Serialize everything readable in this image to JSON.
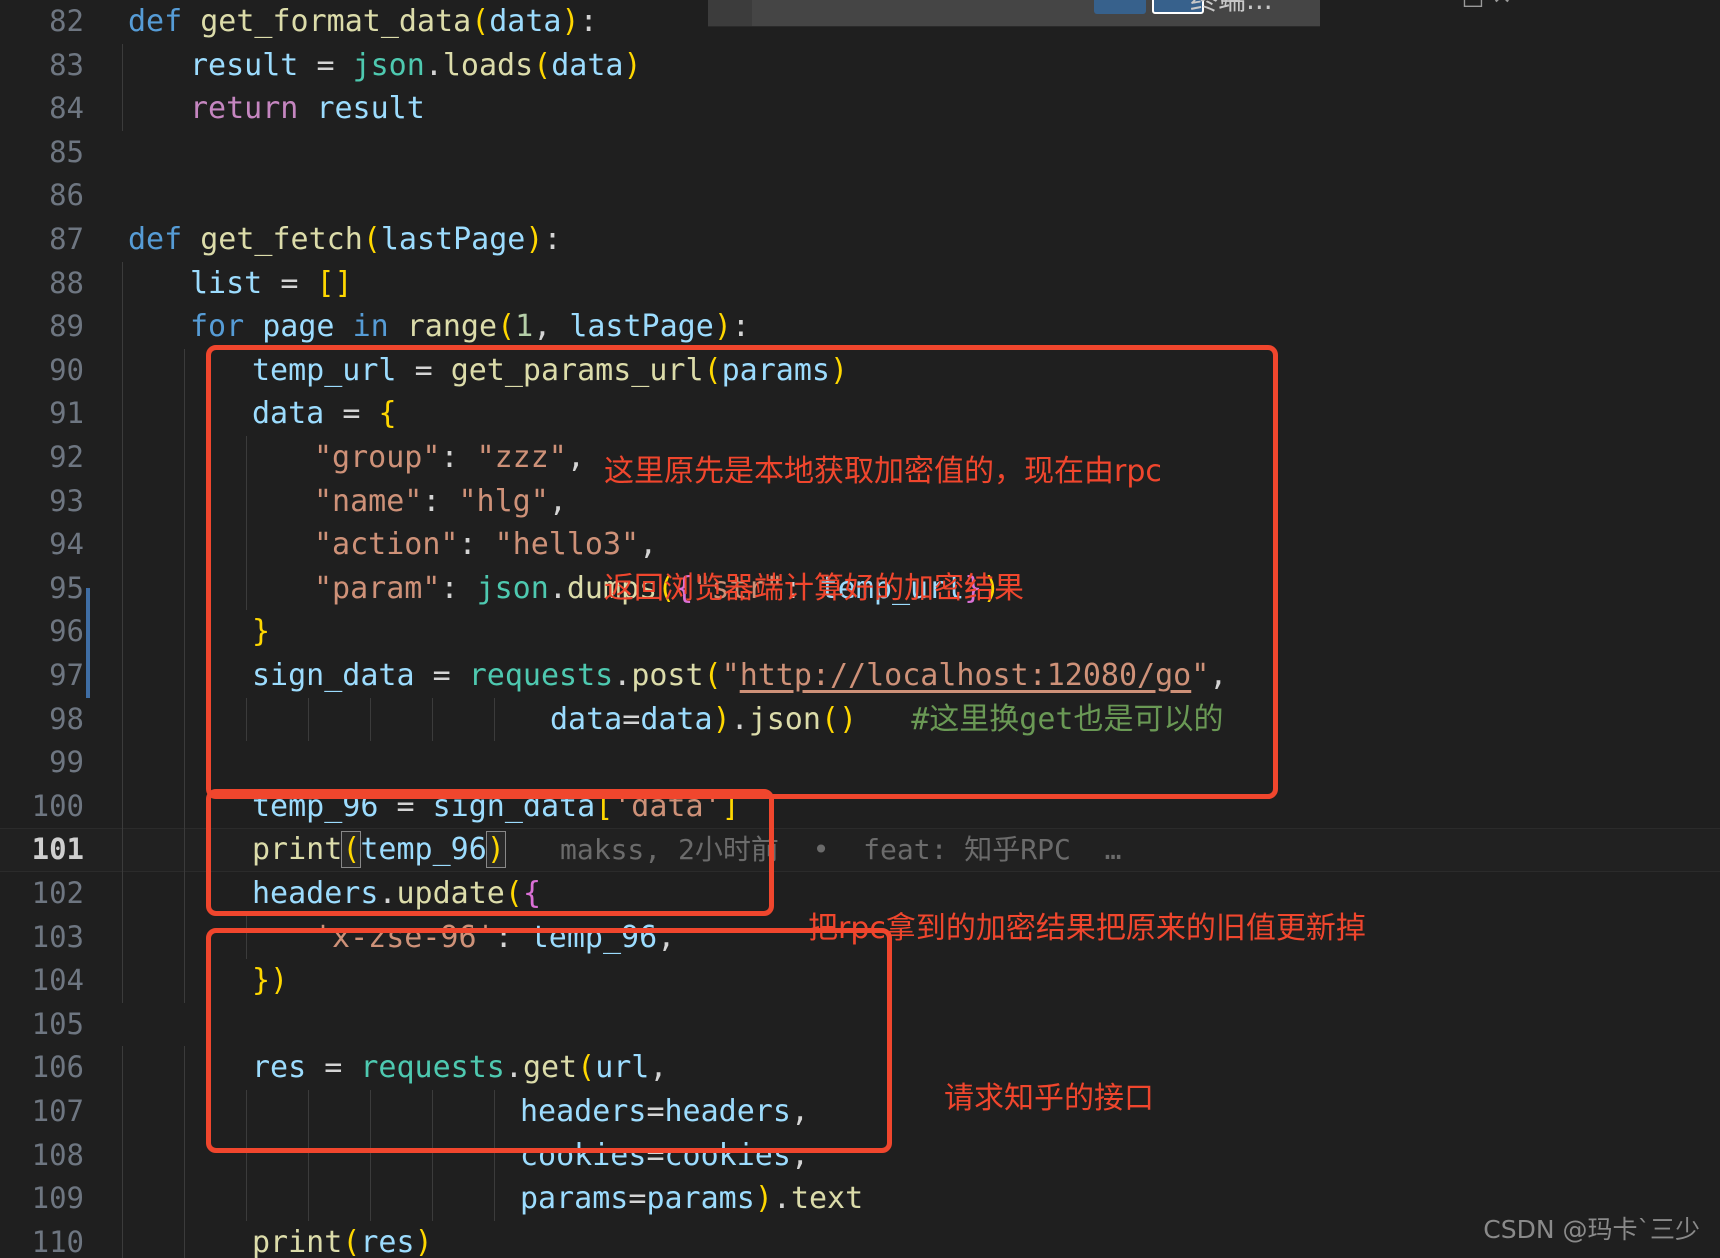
{
  "window": {
    "theme_background": "#1f1f1f",
    "accent_annotation_color": "#f0462d",
    "terminal_label": "终端...",
    "terminal_icons": "—  □  ✕"
  },
  "editor": {
    "first_line_number": 82,
    "current_line_number": 101,
    "lines": [
      {
        "n": "82",
        "indent": 0,
        "text": "def get_format_data(data):"
      },
      {
        "n": "83",
        "indent": 1,
        "text": "result = json.loads(data)"
      },
      {
        "n": "84",
        "indent": 1,
        "text": "return result"
      },
      {
        "n": "85",
        "indent": 0,
        "text": ""
      },
      {
        "n": "86",
        "indent": 0,
        "text": ""
      },
      {
        "n": "87",
        "indent": 0,
        "text": "def get_fetch(lastPage):"
      },
      {
        "n": "88",
        "indent": 1,
        "text": "list = []"
      },
      {
        "n": "89",
        "indent": 1,
        "text": "for page in range(1, lastPage):"
      },
      {
        "n": "90",
        "indent": 2,
        "text": "temp_url = get_params_url(params)"
      },
      {
        "n": "91",
        "indent": 2,
        "text": "data = {"
      },
      {
        "n": "92",
        "indent": 3,
        "text": "\"group\": \"zzz\","
      },
      {
        "n": "93",
        "indent": 3,
        "text": "\"name\": \"hlg\","
      },
      {
        "n": "94",
        "indent": 3,
        "text": "\"action\": \"hello3\","
      },
      {
        "n": "95",
        "indent": 3,
        "text": "\"param\": json.dumps({\"str\": temp_url})"
      },
      {
        "n": "96",
        "indent": 2,
        "text": "}"
      },
      {
        "n": "97",
        "indent": 2,
        "text": "sign_data = requests.post(\"http://localhost:12080/go\","
      },
      {
        "n": "98",
        "indent": 2,
        "text": "data=data).json()   #这里换get也是可以的"
      },
      {
        "n": "99",
        "indent": 2,
        "text": ""
      },
      {
        "n": "100",
        "indent": 2,
        "text": "temp_96 = sign_data['data']"
      },
      {
        "n": "101",
        "indent": 2,
        "text": "print(temp_96)"
      },
      {
        "n": "102",
        "indent": 2,
        "text": "headers.update({"
      },
      {
        "n": "103",
        "indent": 3,
        "text": "'x-zse-96': temp_96,"
      },
      {
        "n": "104",
        "indent": 2,
        "text": "})"
      },
      {
        "n": "105",
        "indent": 0,
        "text": ""
      },
      {
        "n": "106",
        "indent": 2,
        "text": "res = requests.get(url,"
      },
      {
        "n": "107",
        "indent": 2,
        "text": "headers=headers,"
      },
      {
        "n": "108",
        "indent": 2,
        "text": "cookies=cookies,"
      },
      {
        "n": "109",
        "indent": 2,
        "text": "params=params).text"
      },
      {
        "n": "110",
        "indent": 2,
        "text": "print(res)"
      }
    ],
    "blame": {
      "author": "makss",
      "time": "2小时前",
      "separator": "•",
      "message": "feat: 知乎RPC",
      "ellipsis": "…",
      "full": "makss, 2小时前  •  feat: 知乎RPC  …"
    }
  },
  "annotations": [
    {
      "id": "annotation-rpc-encryption",
      "line1": "这里原先是本地获取加密值的，现在由rpc",
      "line2": "返回浏览器端计算好的加密结果"
    },
    {
      "id": "annotation-update-header",
      "line1": "把rpc拿到的加密结果把原来的旧值更新掉"
    },
    {
      "id": "annotation-zhihu-api",
      "line1": "请求知乎的接口"
    }
  ],
  "watermark": "CSDN @玛卡`三少"
}
